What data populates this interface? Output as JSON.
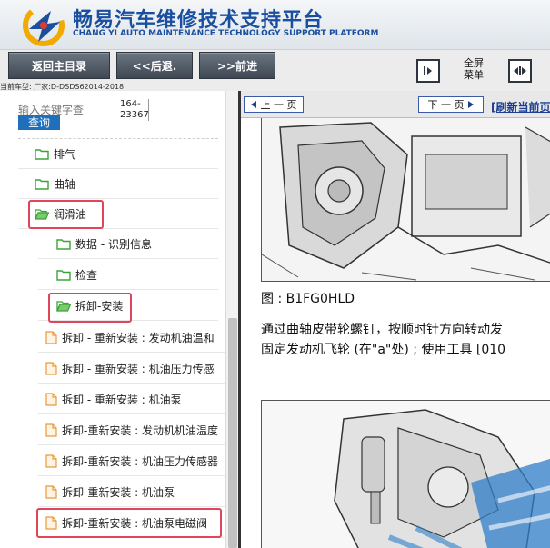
{
  "header": {
    "title_cn": "畅易汽车维修技术支持平台",
    "title_en": "CHANG YI AUTO MAINTENANCE TECHNOLOGY SUPPORT PLATFORM"
  },
  "toolbar": {
    "back_main": "返回主目录",
    "back": "<<后退.",
    "forward": ">>前进",
    "fullscreen_line1": "全屏",
    "fullscreen_line2": "菜单",
    "vehicle_info": "当前车型:  厂家:D-DSDS62014-2018"
  },
  "search": {
    "placeholder": "输入关键字查",
    "code_line1": "164-",
    "code_line2": "23367",
    "button": "查询"
  },
  "tree": [
    {
      "label": "排气",
      "type": "folder"
    },
    {
      "label": "曲轴",
      "type": "folder"
    },
    {
      "label": "润滑油",
      "type": "folder-open"
    },
    {
      "label": "数据 - 识别信息",
      "type": "folder"
    },
    {
      "label": "检查",
      "type": "folder"
    },
    {
      "label": "拆卸-安装",
      "type": "folder-open"
    },
    {
      "label": "拆卸 - 重新安装 : 发动机油温和",
      "type": "doc"
    },
    {
      "label": "拆卸 - 重新安装 : 机油压力传感",
      "type": "doc"
    },
    {
      "label": "拆卸 - 重新安装 : 机油泵",
      "type": "doc"
    },
    {
      "label": "拆卸-重新安装 : 发动机机油温度",
      "type": "doc"
    },
    {
      "label": "拆卸-重新安装 : 机油压力传感器",
      "type": "doc"
    },
    {
      "label": "拆卸-重新安装 : 机油泵",
      "type": "doc"
    },
    {
      "label": "拆卸-重新安装 : 机油泵电磁阀",
      "type": "doc"
    }
  ],
  "content": {
    "prev_page": "上 一 页",
    "next_page": "下 一 页",
    "refresh": "[刷新当前页",
    "caption": "图 : B1FG0HLD",
    "para_line1": "通过曲轴皮带轮螺钉，按顺时针方向转动发",
    "para_line2": "固定发动机飞轮 (在\"a\"处) ; 使用工具 [010"
  },
  "colors": {
    "brand_blue": "#1a4fa0",
    "highlight_red": "#e0455a",
    "folder_green": "#3aa535",
    "doc_orange": "#e89a3c"
  }
}
